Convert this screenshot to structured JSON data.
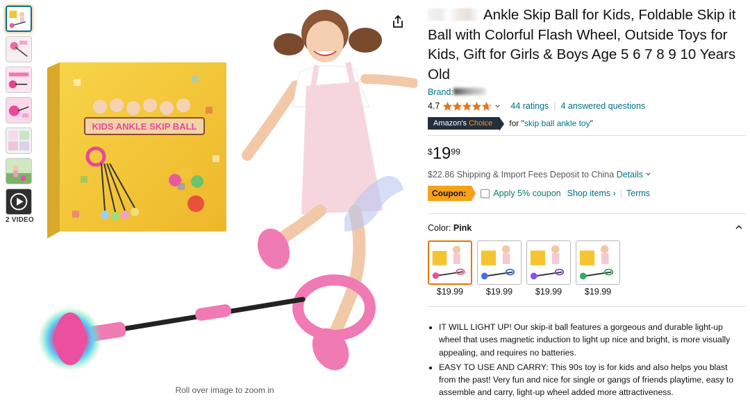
{
  "thumbnails": {
    "video_label": "2 VIDEO"
  },
  "main": {
    "zoom_hint": "Roll over image to zoom in",
    "box_text": "KIDS ANKLE SKIP BALL"
  },
  "product": {
    "title": "Ankle Skip Ball for Kids, Foldable Skip it Ball with Colorful Flash Wheel, Outside Toys for Kids, Gift for Girls & Boys Age 5 6 7 8 9 10 Years Old",
    "brand_label": "Brand:",
    "rating_value": "4.7",
    "rating_stars": 4.7,
    "ratings_count": "44 ratings",
    "answered": "4 answered questions",
    "choice_badge_a": "Amazon's ",
    "choice_badge_b": "Choice",
    "choice_for_prefix": "for \"",
    "choice_for_link": "skip ball ankle toy",
    "choice_for_suffix": "\"",
    "price_symbol": "$",
    "price_whole": "19",
    "price_fraction": "99",
    "shipping_text": "$22.86 Shipping & Import Fees Deposit to China ",
    "shipping_link": "Details",
    "coupon_label": "Coupon:",
    "coupon_text": "Apply 5% coupon",
    "shop_items": "Shop items ›",
    "terms": "Terms",
    "color_label": "Color: ",
    "color_value": "Pink"
  },
  "swatches": [
    {
      "price": "$19.99"
    },
    {
      "price": "$19.99"
    },
    {
      "price": "$19.99"
    },
    {
      "price": "$19.99"
    }
  ],
  "bullets": [
    "IT WILL LIGHT UP! Our skip-it ball features a gorgeous and durable light-up wheel that uses magnetic induction to light up nice and bright, is more visually appealing, and requires no batteries.",
    "EASY TO USE AND CARRY: This 90s toy is for kids and also helps you blast from the past! Very fun and nice for single or gangs of friends playtime, easy to assemble and carry, light-up wheel added more attractiveness."
  ],
  "colors": {
    "link": "#007185",
    "price_text": "#0f1111",
    "coupon": "#f7a21b",
    "accent": "#ff9900",
    "badge": "#232f3e",
    "pink": "#f07ab3"
  },
  "icons": [
    "share-icon",
    "star-icon",
    "chevron-down-icon",
    "chevron-up-icon",
    "play-icon"
  ]
}
